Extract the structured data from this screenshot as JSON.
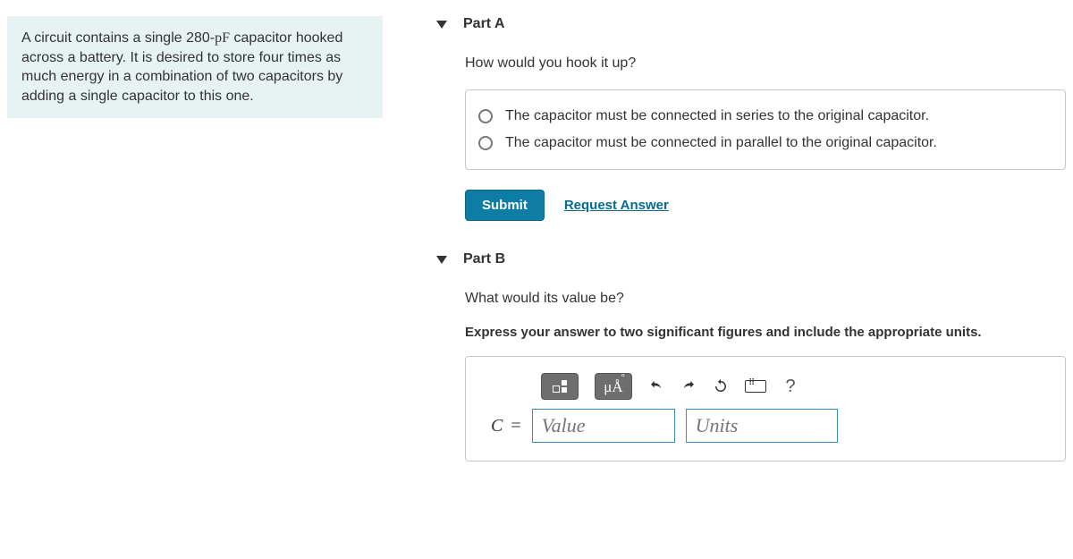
{
  "problem": {
    "prefix": "A circuit contains a single 280-",
    "unit": "pF",
    "suffix": " capacitor hooked across a battery. It is desired to store four times as much energy in a combination of two capacitors by adding a single capacitor to this one."
  },
  "partA": {
    "title": "Part A",
    "question": "How would you hook it up?",
    "options": [
      "The capacitor must be connected in series to the original capacitor.",
      "The capacitor must be connected in parallel to the original capacitor."
    ],
    "submit_label": "Submit",
    "request_label": "Request Answer"
  },
  "partB": {
    "title": "Part B",
    "question": "What would its value be?",
    "instruction": "Express your answer to two significant figures and include the appropriate units.",
    "mu_angstrom": "μÅ",
    "help_symbol": "?",
    "var_label": "C",
    "equals": " =",
    "value_placeholder": "Value",
    "units_placeholder": "Units"
  }
}
